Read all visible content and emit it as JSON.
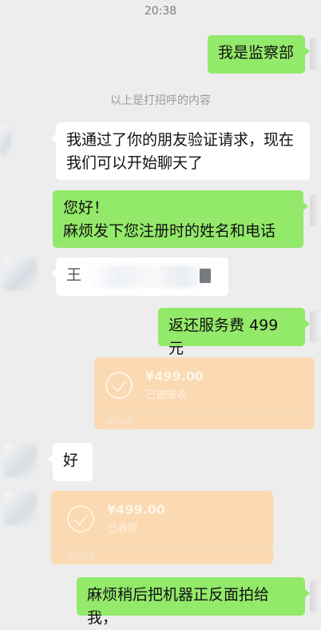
{
  "status_time": "20:38",
  "system_note": "以上是打招呼的内容",
  "messages": {
    "m1": "我是监察部",
    "m2_line1": "我通过了你的朋友验证请求，现在",
    "m2_line2": "我们可以开始聊天了",
    "m3_line1": "您好！",
    "m3_line2": "麻烦发下您注册时的姓名和电话",
    "m4_visible": "王",
    "m5": "返还服务费 499 元",
    "m7": "好",
    "m9": "麻烦稍后把机器正反面拍给我，"
  },
  "transfers": [
    {
      "amount": "¥499.00",
      "status": "已被接收",
      "footer": "微信转账"
    },
    {
      "amount": "¥499.00",
      "status": "已收款",
      "footer": "微信转账"
    }
  ],
  "colors": {
    "background": "#ededed",
    "sent_bubble": "#93e96a",
    "received_bubble": "#ffffff",
    "transfer_card": "#fad9b3"
  }
}
